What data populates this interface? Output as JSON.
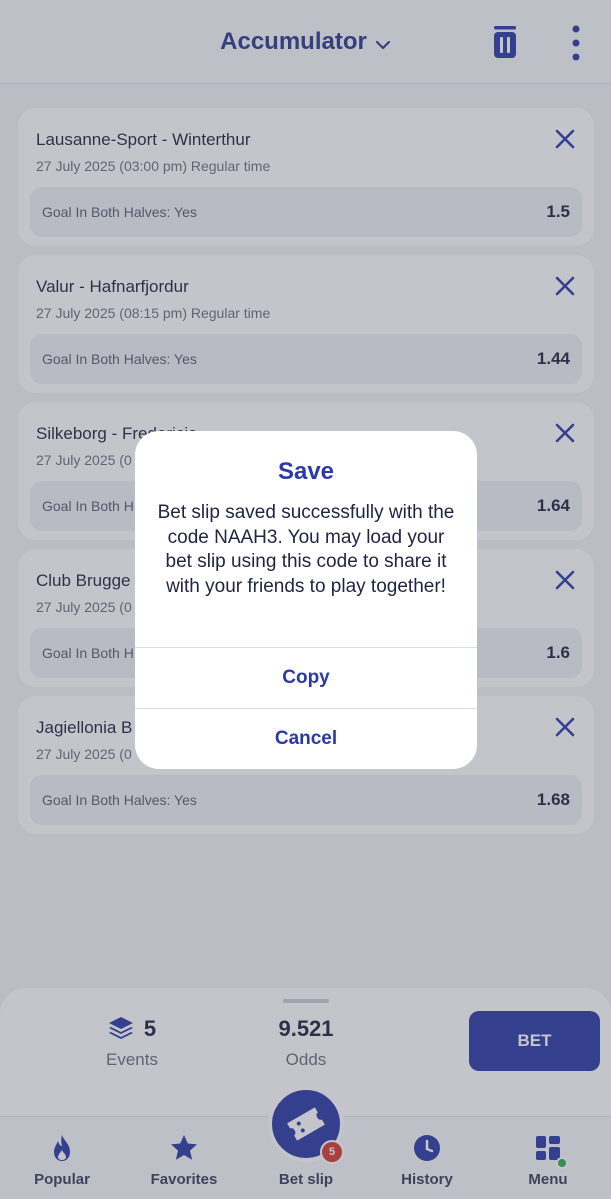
{
  "header": {
    "title": "Accumulator"
  },
  "bets": [
    {
      "match": "Lausanne-Sport - Winterthur",
      "date": "27 July 2025 (03:00 pm) Regular time",
      "market": "Goal In Both Halves: Yes",
      "odd": "1.5"
    },
    {
      "match": "Valur - Hafnarfjordur",
      "date": "27 July 2025 (08:15 pm) Regular time",
      "market": "Goal In Both Halves: Yes",
      "odd": "1.44"
    },
    {
      "match": "Silkeborg - Fredericia",
      "date": "27 July 2025 (0",
      "market": "Goal In Both H",
      "odd": "1.64"
    },
    {
      "match": "Club Brugge -",
      "date": "27 July 2025 (0",
      "market": "Goal In Both H",
      "odd": "1.6"
    },
    {
      "match": "Jagiellonia B",
      "date": "27 July 2025 (0",
      "market": "Goal In Both Halves: Yes",
      "odd": "1.68"
    }
  ],
  "summary": {
    "events_value": "5",
    "events_label": "Events",
    "odds_value": "9.521",
    "odds_label": "Odds",
    "bet_label": "BET"
  },
  "tabs": [
    {
      "label": "Popular",
      "icon": "flame-icon"
    },
    {
      "label": "Favorites",
      "icon": "star-icon"
    },
    {
      "label": "Bet slip",
      "icon": "ticket-icon",
      "badge": "5"
    },
    {
      "label": "History",
      "icon": "clock-icon"
    },
    {
      "label": "Menu",
      "icon": "grid-icon"
    }
  ],
  "dialog": {
    "title": "Save",
    "message": "Bet slip saved successfully with the code NAAH3. You may load your bet slip using this code to share it with your friends to play together!",
    "copy_label": "Copy",
    "cancel_label": "Cancel"
  },
  "colors": {
    "primary": "#2b3aa6",
    "badge": "#d63b2f",
    "online_dot": "#2fae4f"
  }
}
